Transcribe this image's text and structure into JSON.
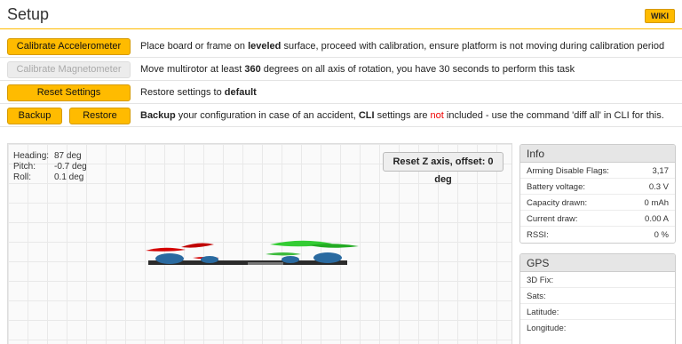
{
  "header": {
    "title": "Setup",
    "wiki_label": "WIKI"
  },
  "rows": [
    {
      "buttons": [
        "Calibrate Accelerometer"
      ],
      "desc_pre": "Place board or frame on ",
      "desc_bold": "leveled",
      "desc_post": " surface, proceed with calibration, ensure platform is not moving during calibration period"
    },
    {
      "buttons": [
        "Calibrate Magnetometer"
      ],
      "desc_pre": "Move multirotor at least ",
      "desc_bold": "360",
      "desc_post": " degrees on all axis of rotation, you have 30 seconds to perform this task"
    },
    {
      "buttons": [
        "Reset Settings"
      ],
      "desc_pre": "Restore settings to ",
      "desc_bold": "default",
      "desc_post": ""
    },
    {
      "buttons": [
        "Backup",
        "Restore"
      ],
      "desc_bold1": "Backup",
      "desc_mid1": " your configuration in case of an accident, ",
      "desc_bold2": "CLI",
      "desc_mid2": " settings are ",
      "desc_red": "not",
      "desc_post": " included - use the command 'diff all' in CLI for this."
    }
  ],
  "attitude": {
    "heading_label": "Heading:",
    "heading_value": "87 deg",
    "pitch_label": "Pitch:",
    "pitch_value": "-0.7 deg",
    "roll_label": "Roll:",
    "roll_value": "0.1 deg"
  },
  "reset_z_label": "Reset Z axis, offset: 0 deg",
  "info": {
    "title": "Info",
    "rows": [
      {
        "label": "Arming Disable Flags:",
        "value": "3,17"
      },
      {
        "label": "Battery voltage:",
        "value": "0.3 V"
      },
      {
        "label": "Capacity drawn:",
        "value": "0 mAh"
      },
      {
        "label": "Current draw:",
        "value": "0.00 A"
      },
      {
        "label": "RSSI:",
        "value": "0 %"
      }
    ]
  },
  "gps": {
    "title": "GPS",
    "rows": [
      {
        "label": "3D Fix:",
        "value": ""
      },
      {
        "label": "Sats:",
        "value": ""
      },
      {
        "label": "Latitude:",
        "value": ""
      },
      {
        "label": "Longitude:",
        "value": ""
      }
    ]
  },
  "colors": {
    "accent": "#ffbb00",
    "prop_front": "#d40000",
    "prop_rear": "#22bb22",
    "motor": "#2a6aa0"
  }
}
